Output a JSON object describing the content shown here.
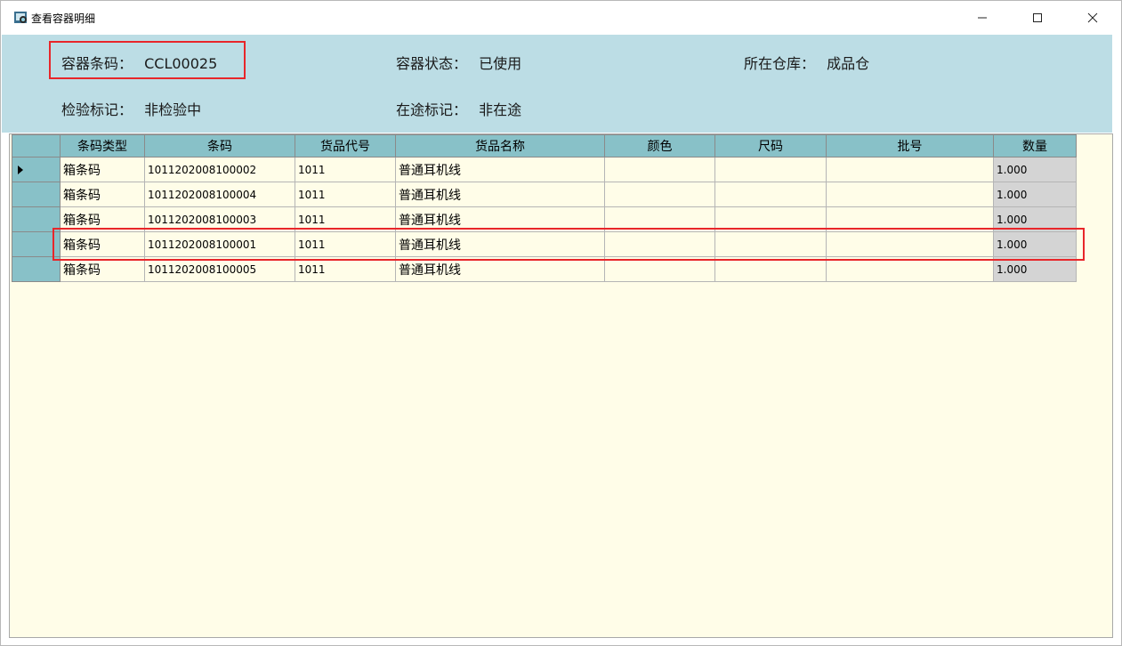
{
  "window": {
    "title": "查看容器明细"
  },
  "info": {
    "container_code_label": "容器条码：",
    "container_code_value": "CCL00025",
    "container_status_label": "容器状态：",
    "container_status_value": "已使用",
    "warehouse_label": "所在仓库：",
    "warehouse_value": "成品仓",
    "inspection_label": "检验标记：",
    "inspection_value": "非检验中",
    "transit_label": "在途标记：",
    "transit_value": "非在途"
  },
  "grid": {
    "columns": [
      "条码类型",
      "条码",
      "货品代号",
      "货品名称",
      "颜色",
      "尺码",
      "批号",
      "数量"
    ],
    "rows": [
      [
        "箱条码",
        "1011202008100002",
        "1011",
        "普通耳机线",
        "",
        "",
        "",
        "1.000"
      ],
      [
        "箱条码",
        "1011202008100004",
        "1011",
        "普通耳机线",
        "",
        "",
        "",
        "1.000"
      ],
      [
        "箱条码",
        "1011202008100003",
        "1011",
        "普通耳机线",
        "",
        "",
        "",
        "1.000"
      ],
      [
        "箱条码",
        "1011202008100001",
        "1011",
        "普通耳机线",
        "",
        "",
        "",
        "1.000"
      ],
      [
        "箱条码",
        "1011202008100005",
        "1011",
        "普通耳机线",
        "",
        "",
        "",
        "1.000"
      ]
    ],
    "current_row": 0
  },
  "colors": {
    "panel_bg": "#bcdde5",
    "header_bg": "#88c1c8",
    "grid_bg": "#fffde8",
    "highlight": "#e8262a"
  }
}
